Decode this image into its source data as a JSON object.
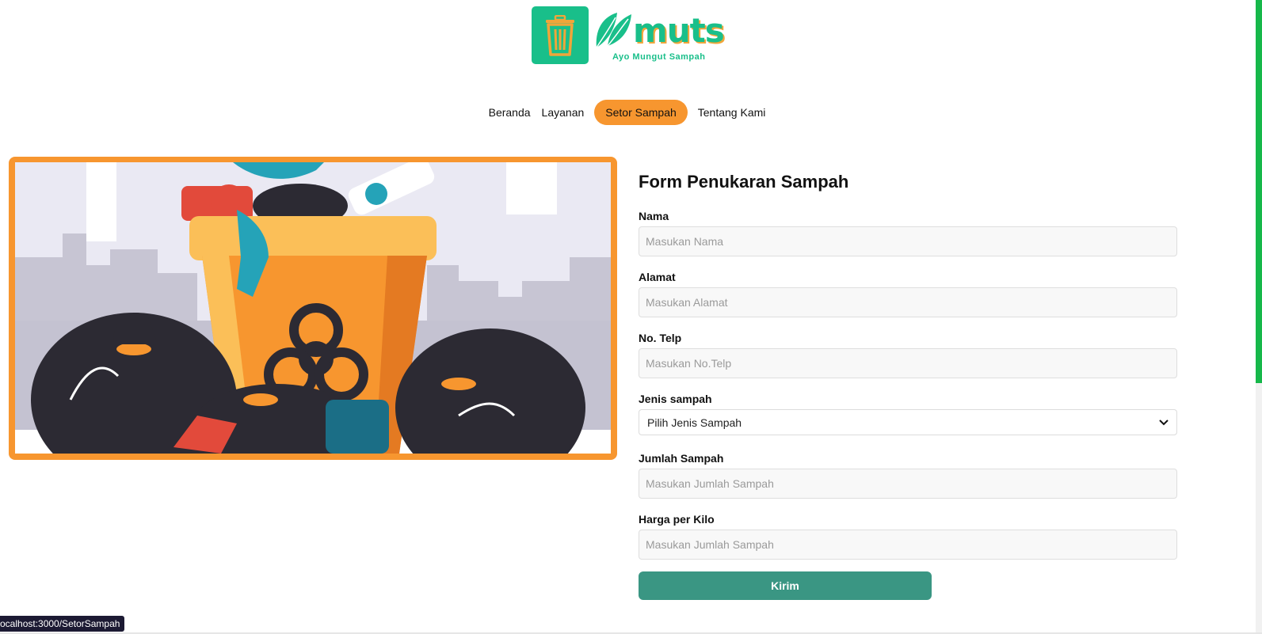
{
  "brand": {
    "name": "muts",
    "tagline": "Ayo Mungut Sampah",
    "primary_color": "#19bf8a",
    "accent_color": "#f7962f",
    "icons": [
      "trash-can-icon",
      "leaf-icon"
    ]
  },
  "nav": {
    "items": [
      {
        "label": "Beranda",
        "active": false
      },
      {
        "label": "Layanan",
        "active": false
      },
      {
        "label": "Setor Sampah",
        "active": true
      },
      {
        "label": "Tentang Kami",
        "active": false
      }
    ]
  },
  "form": {
    "title": "Form Penukaran Sampah",
    "nama": {
      "label": "Nama",
      "placeholder": "Masukan Nama"
    },
    "alamat": {
      "label": "Alamat",
      "placeholder": "Masukan Alamat"
    },
    "telp": {
      "label": "No. Telp",
      "placeholder": "Masukan No.Telp"
    },
    "jenis": {
      "label": "Jenis sampah",
      "selected": "Pilih Jenis Sampah"
    },
    "jumlah": {
      "label": "Jumlah Sampah",
      "placeholder": "Masukan Jumlah Sampah"
    },
    "harga": {
      "label": "Harga per Kilo",
      "placeholder": "Masukan Jumlah Sampah"
    },
    "submit_label": "Kirim",
    "submit_color": "#3a9683"
  },
  "status_bar": {
    "url": "ocalhost:3000/SetorSampah"
  }
}
